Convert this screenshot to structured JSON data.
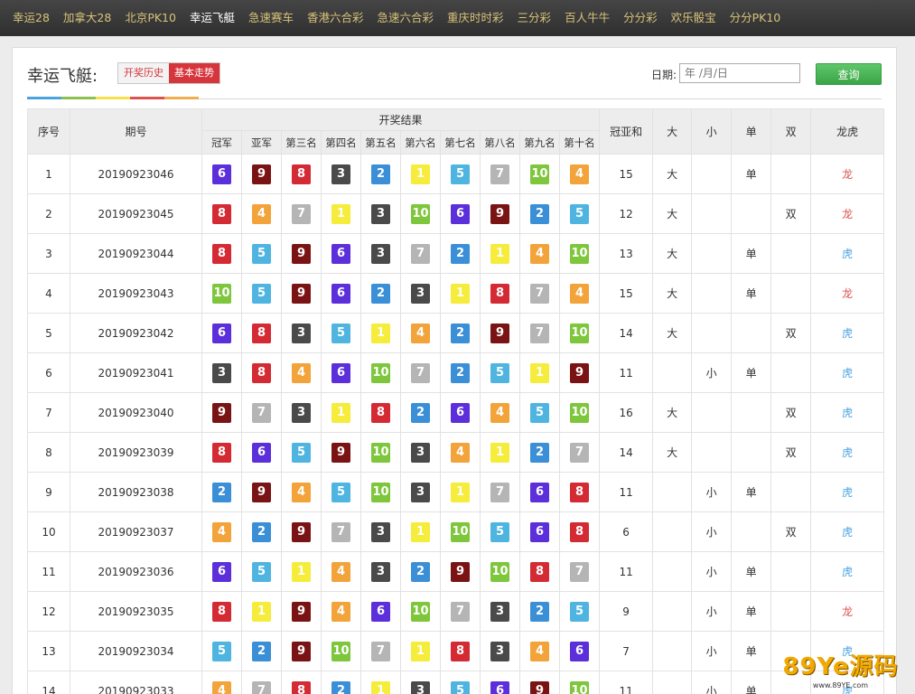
{
  "nav": {
    "items": [
      "幸运28",
      "加拿大28",
      "北京PK10",
      "幸运飞艇",
      "急速赛车",
      "香港六合彩",
      "急速六合彩",
      "重庆时时彩",
      "三分彩",
      "百人牛牛",
      "分分彩",
      "欢乐骰宝",
      "分分PK10"
    ],
    "active_index": 3
  },
  "header": {
    "title": "幸运飞艇:",
    "tab_history": "开奖历史",
    "tab_trend": "基本走势",
    "date_label": "日期:",
    "date_placeholder": "年 /月/日",
    "query_label": "查询",
    "rainbow_colors": [
      "#4aa3df",
      "#8cc152",
      "#f6e04b",
      "#d9534f",
      "#f0ad4e"
    ]
  },
  "table": {
    "headers": {
      "seq": "序号",
      "issue": "期号",
      "result": "开奖结果",
      "positions": [
        "冠军",
        "亚军",
        "第三名",
        "第四名",
        "第五名",
        "第六名",
        "第七名",
        "第八名",
        "第九名",
        "第十名"
      ],
      "sum": "冠亚和",
      "big": "大",
      "small": "小",
      "odd": "单",
      "even": "双",
      "dragon_tiger": "龙虎"
    },
    "rows": [
      {
        "seq": "1",
        "issue": "20190923046",
        "balls": [
          6,
          9,
          8,
          3,
          2,
          1,
          5,
          7,
          10,
          4
        ],
        "sum": "15",
        "big": "大",
        "small": "",
        "odd": "单",
        "even": "",
        "lh": "龙"
      },
      {
        "seq": "2",
        "issue": "20190923045",
        "balls": [
          8,
          4,
          7,
          1,
          3,
          10,
          6,
          9,
          2,
          5
        ],
        "sum": "12",
        "big": "大",
        "small": "",
        "odd": "",
        "even": "双",
        "lh": "龙"
      },
      {
        "seq": "3",
        "issue": "20190923044",
        "balls": [
          8,
          5,
          9,
          6,
          3,
          7,
          2,
          1,
          4,
          10
        ],
        "sum": "13",
        "big": "大",
        "small": "",
        "odd": "单",
        "even": "",
        "lh": "虎"
      },
      {
        "seq": "4",
        "issue": "20190923043",
        "balls": [
          10,
          5,
          9,
          6,
          2,
          3,
          1,
          8,
          7,
          4
        ],
        "sum": "15",
        "big": "大",
        "small": "",
        "odd": "单",
        "even": "",
        "lh": "龙"
      },
      {
        "seq": "5",
        "issue": "20190923042",
        "balls": [
          6,
          8,
          3,
          5,
          1,
          4,
          2,
          9,
          7,
          10
        ],
        "sum": "14",
        "big": "大",
        "small": "",
        "odd": "",
        "even": "双",
        "lh": "虎"
      },
      {
        "seq": "6",
        "issue": "20190923041",
        "balls": [
          3,
          8,
          4,
          6,
          10,
          7,
          2,
          5,
          1,
          9
        ],
        "sum": "11",
        "big": "",
        "small": "小",
        "odd": "单",
        "even": "",
        "lh": "虎"
      },
      {
        "seq": "7",
        "issue": "20190923040",
        "balls": [
          9,
          7,
          3,
          1,
          8,
          2,
          6,
          4,
          5,
          10
        ],
        "sum": "16",
        "big": "大",
        "small": "",
        "odd": "",
        "even": "双",
        "lh": "虎"
      },
      {
        "seq": "8",
        "issue": "20190923039",
        "balls": [
          8,
          6,
          5,
          9,
          10,
          3,
          4,
          1,
          2,
          7
        ],
        "sum": "14",
        "big": "大",
        "small": "",
        "odd": "",
        "even": "双",
        "lh": "虎"
      },
      {
        "seq": "9",
        "issue": "20190923038",
        "balls": [
          2,
          9,
          4,
          5,
          10,
          3,
          1,
          7,
          6,
          8
        ],
        "sum": "11",
        "big": "",
        "small": "小",
        "odd": "单",
        "even": "",
        "lh": "虎"
      },
      {
        "seq": "10",
        "issue": "20190923037",
        "balls": [
          4,
          2,
          9,
          7,
          3,
          1,
          10,
          5,
          6,
          8
        ],
        "sum": "6",
        "big": "",
        "small": "小",
        "odd": "",
        "even": "双",
        "lh": "虎"
      },
      {
        "seq": "11",
        "issue": "20190923036",
        "balls": [
          6,
          5,
          1,
          4,
          3,
          2,
          9,
          10,
          8,
          7
        ],
        "sum": "11",
        "big": "",
        "small": "小",
        "odd": "单",
        "even": "",
        "lh": "虎"
      },
      {
        "seq": "12",
        "issue": "20190923035",
        "balls": [
          8,
          1,
          9,
          4,
          6,
          10,
          7,
          3,
          2,
          5
        ],
        "sum": "9",
        "big": "",
        "small": "小",
        "odd": "单",
        "even": "",
        "lh": "龙"
      },
      {
        "seq": "13",
        "issue": "20190923034",
        "balls": [
          5,
          2,
          9,
          10,
          7,
          1,
          8,
          3,
          4,
          6
        ],
        "sum": "7",
        "big": "",
        "small": "小",
        "odd": "单",
        "even": "",
        "lh": "虎"
      },
      {
        "seq": "14",
        "issue": "20190923033",
        "balls": [
          4,
          7,
          8,
          2,
          1,
          3,
          5,
          6,
          9,
          10
        ],
        "sum": "11",
        "big": "",
        "small": "小",
        "odd": "单",
        "even": "",
        "lh": "虎"
      }
    ],
    "ball_colors": {
      "1": "#f5ec3c",
      "2": "#3b8fd6",
      "3": "#4a4a4a",
      "4": "#f2a33a",
      "5": "#4fb5e0",
      "6": "#5b2fd9",
      "7": "#b5b5b5",
      "8": "#d42a34",
      "9": "#7a1414",
      "10": "#7ec63c"
    },
    "dragon_color": "#d9534f",
    "tiger_color": "#4aa3df"
  },
  "watermark": {
    "brand": "89Ye源码",
    "url": "www.89YE.com"
  }
}
